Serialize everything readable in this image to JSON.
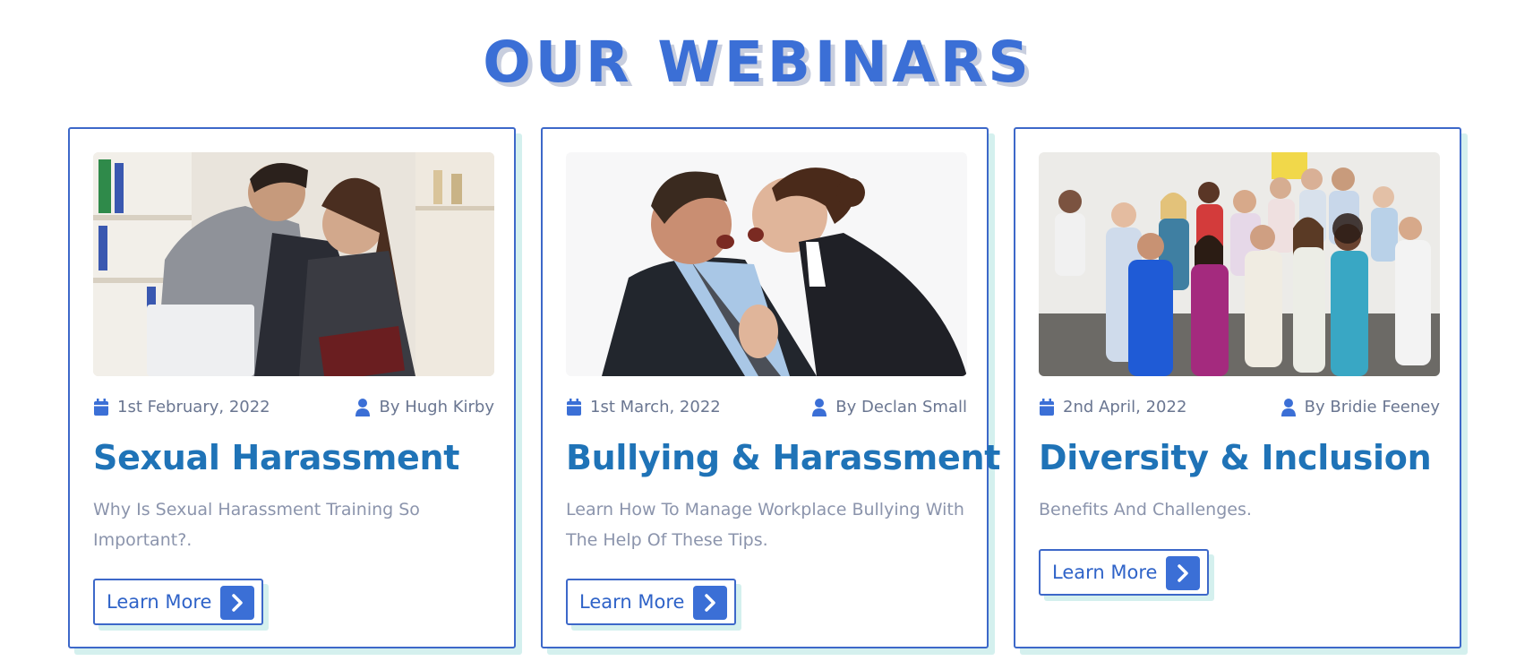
{
  "section": {
    "title": "OUR WEBINARS"
  },
  "cards": [
    {
      "date": "1st February, 2022",
      "author": "By Hugh Kirby",
      "title": "Sexual Harassment",
      "description": "Why Is Sexual Harassment Training So Important?.",
      "button": "Learn More",
      "image": "office-harassment-photo"
    },
    {
      "date": "1st March, 2022",
      "author": "By Declan Small",
      "title": "Bullying & Harassment",
      "description": "Learn How To Manage Workplace Bullying With The Help Of These Tips.",
      "button": "Learn More",
      "image": "workplace-argument-photo"
    },
    {
      "date": "2nd April, 2022",
      "author": "By Bridie Feeney",
      "title": "Diversity & Inclusion",
      "description": "Benefits And Challenges.",
      "button": "Learn More",
      "image": "diverse-team-photo"
    }
  ],
  "icons": {
    "date": "calendar-icon",
    "author": "user-icon",
    "button": "chevron-right-icon"
  },
  "colors": {
    "accent": "#3b6fd6",
    "heading": "#1f73b7",
    "border": "#3d68c9",
    "shadow": "#d4f0ee",
    "muted": "#8b94ac"
  }
}
